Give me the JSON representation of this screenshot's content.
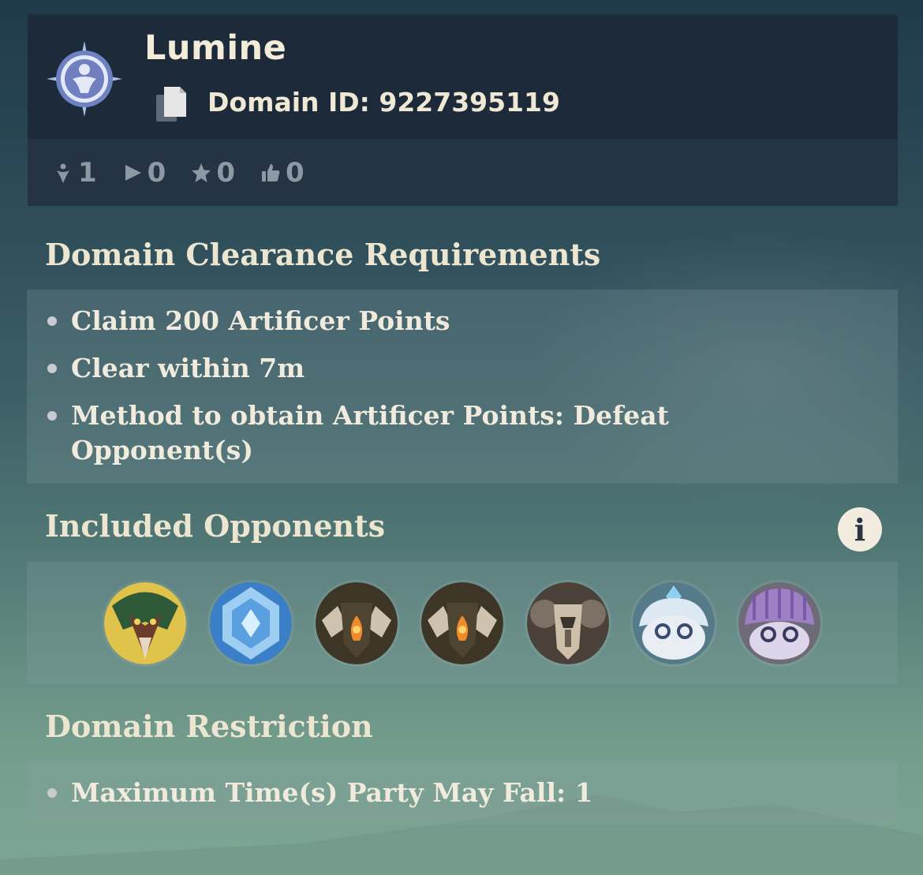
{
  "author": {
    "name": "Lumine",
    "emblem_icon": "compass-avatar-icon"
  },
  "domain": {
    "id_text": "Domain ID: 9227395119",
    "copy_icon": "copy-icon"
  },
  "stats": [
    {
      "icon": "player-icon",
      "value": "1"
    },
    {
      "icon": "play-icon",
      "value": "0"
    },
    {
      "icon": "star-icon",
      "value": "0"
    },
    {
      "icon": "thumbs-up-icon",
      "value": "0"
    }
  ],
  "clearance": {
    "title": "Domain Clearance Requirements",
    "items": [
      "Claim 200 Artificer Points",
      "Clear within 7m",
      "Method to obtain Artificer Points: Defeat Opponent(s)"
    ]
  },
  "opponents": {
    "title": "Included Opponents",
    "info_label": "i",
    "icons": [
      "green-boss-icon",
      "cryo-crystal-icon",
      "ruin-guard-icon",
      "ruin-guard-icon",
      "ruin-hunter-icon",
      "cryo-slime-icon",
      "electro-jellyfish-icon"
    ]
  },
  "restriction": {
    "title": "Domain Restriction",
    "items": [
      "Maximum Time(s) Party May Fall: 1"
    ]
  },
  "colors": {
    "card_bg": "#1c2a3a",
    "stats_bg": "#243444",
    "text_cream": "#ece5cf",
    "stat_gray": "#8c98a4"
  }
}
